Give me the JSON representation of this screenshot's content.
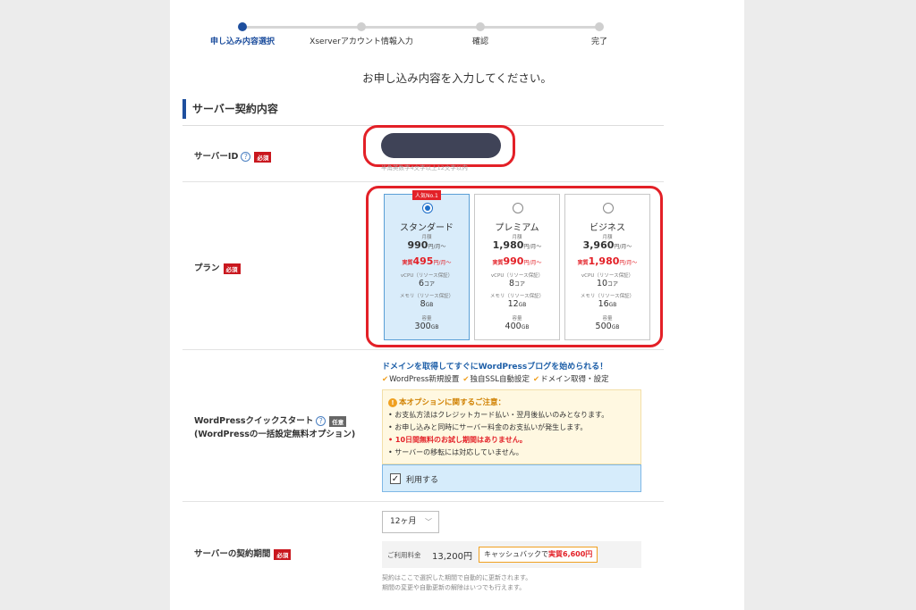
{
  "stepper": {
    "steps": [
      "申し込み内容選択",
      "Xserverアカウント情報入力",
      "確認",
      "完了"
    ],
    "active_index": 0
  },
  "instruction": "お申し込み内容を入力してください。",
  "section_title": "サーバー契約内容",
  "badges": {
    "required": "必須",
    "optional": "任意",
    "help": "?"
  },
  "server_id": {
    "label": "サーバーID",
    "note": "半角英数字4文字以上12文字以内"
  },
  "plan": {
    "label": "プラン",
    "popular_badge": "人気No.1",
    "labels": {
      "monthly": "月額",
      "effective_tag": "実質",
      "price_unit": "円/月〜",
      "vcpu": "vCPU（リソース保証）",
      "memory": "メモリ（リソース保証）",
      "storage": "容量",
      "core_unit": "コア",
      "gb_unit": "GB"
    },
    "options": [
      {
        "name": "スタンダード",
        "price": "990",
        "effective": "495",
        "vcpu": "6",
        "memory": "8",
        "storage": "300",
        "selected": true
      },
      {
        "name": "プレミアム",
        "price": "1,980",
        "effective": "990",
        "vcpu": "8",
        "memory": "12",
        "storage": "400",
        "selected": false
      },
      {
        "name": "ビジネス",
        "price": "3,960",
        "effective": "1,980",
        "vcpu": "10",
        "memory": "16",
        "storage": "500",
        "selected": false
      }
    ]
  },
  "wordpress": {
    "label": "WordPressクイックスタート",
    "sublabel": "(WordPressの一括設定無料オプション)",
    "headline": "ドメインを取得してすぐにWordPressブログを始められる！",
    "features": [
      "WordPress新規設置",
      "独自SSL自動設定",
      "ドメイン取得・設定"
    ],
    "notice_title": "本オプションに関するご注意：",
    "notices": [
      "お支払方法はクレジットカード払い・翌月後払いのみとなります。",
      "お申し込みと同時にサーバー料金のお支払いが発生します。",
      "10日間無料のお試し期間はありません。",
      "サーバーの移転には対応していません。"
    ],
    "use_label": "利用する",
    "use_checked": true
  },
  "contract": {
    "label": "サーバーの契約期間",
    "term": "12ヶ月",
    "fee_label": "ご利用料金",
    "fee_value": "13,200円",
    "cashback_prefix": "キャッシュバックで",
    "cashback_amount": "実質6,600円",
    "note_lines": [
      "契約はここで選択した期間で自動的に更新されます。",
      "期間の変更や自動更新の解除はいつでも行えます。"
    ]
  },
  "colors": {
    "accent": "#1e4f9e",
    "highlight_ring": "#e32027",
    "selected_plan_bg": "#d9ecfa",
    "required_badge": "#c9171e"
  }
}
